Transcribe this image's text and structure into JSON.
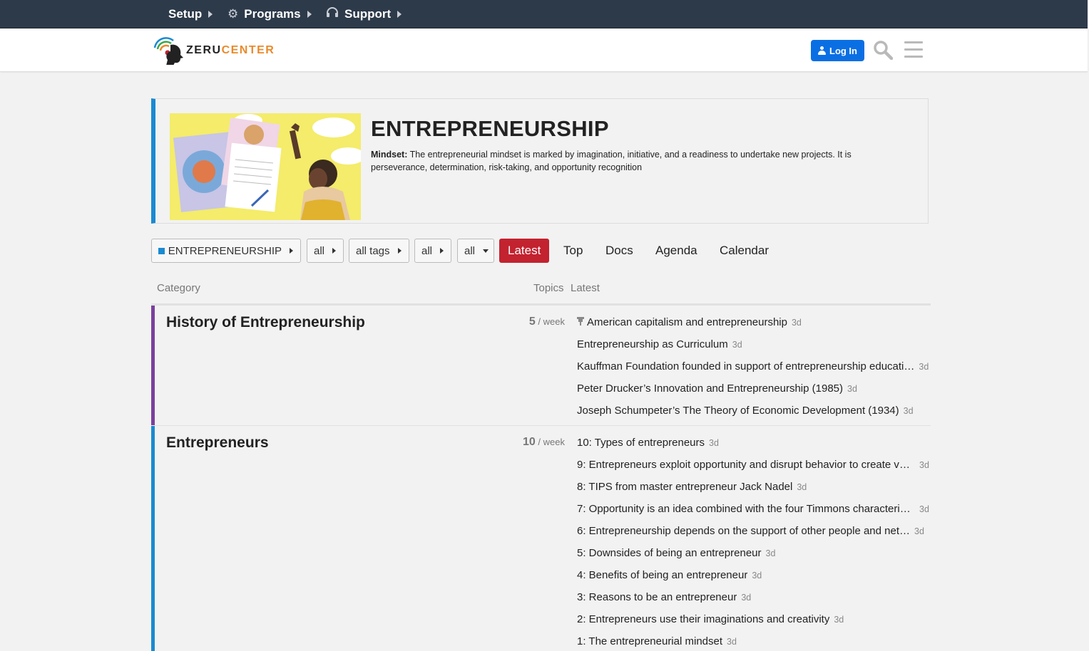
{
  "topnav": {
    "items": [
      {
        "label": "Setup",
        "icon": "none"
      },
      {
        "label": "Programs",
        "icon": "gear-icon"
      },
      {
        "label": "Support",
        "icon": "headset-icon"
      }
    ]
  },
  "header": {
    "logo_text_a": "ZERU",
    "logo_text_b": "CENTER",
    "login_label": "Log In"
  },
  "banner": {
    "title": "ENTREPRENEURSHIP",
    "desc_bold": "Mindset:",
    "desc_text": " The entrepreneurial mindset is marked by imagination, initiative, and a readiness to undertake new projects. It is perseverance, determination, risk-taking, and opportunity recognition",
    "accent_color": "#1a8ad1"
  },
  "filters": {
    "category": "ENTREPRENEURSHIP",
    "sub": "all",
    "tags": "all tags",
    "period": "all",
    "status": "all",
    "tabs": [
      "Latest",
      "Top",
      "Docs",
      "Agenda",
      "Calendar"
    ],
    "active_tab": "Latest",
    "active_color": "#c3222f"
  },
  "table": {
    "headers": {
      "category": "Category",
      "topics": "Topics",
      "latest": "Latest"
    },
    "categories": [
      {
        "name": "History of Entrepreneurship",
        "count": "5",
        "per": " / week",
        "color": "#7b3f9d",
        "topics": [
          {
            "title": "American capitalism and entrepreneurship",
            "age": "3d",
            "pinned": true
          },
          {
            "title": "Entrepreneurship as Curriculum",
            "age": "3d"
          },
          {
            "title": "Kauffman Foundation founded in support of entrepreneurship educati…",
            "age": "3d"
          },
          {
            "title": "Peter Drucker’s Innovation and Entrepreneurship (1985)",
            "age": "3d"
          },
          {
            "title": "Joseph Schumpeter’s The Theory of Economic Development (1934)",
            "age": "3d"
          }
        ]
      },
      {
        "name": "Entrepreneurs",
        "count": "10",
        "per": " / week",
        "color": "#1a8ad1",
        "topics": [
          {
            "title": "10: Types of entrepreneurs",
            "age": "3d"
          },
          {
            "title": "9: Entrepreneurs exploit opportunity and disrupt behavior to create va…",
            "age": "3d"
          },
          {
            "title": "8: TIPS from master entrepreneur Jack Nadel",
            "age": "3d"
          },
          {
            "title": "7: Opportunity is an idea combined with the four Timmons characteris…",
            "age": "3d"
          },
          {
            "title": "6: Entrepreneurship depends on the support of other people and net…",
            "age": "3d"
          },
          {
            "title": "5: Downsides of being an entrepreneur",
            "age": "3d"
          },
          {
            "title": "4: Benefits of being an entrepreneur",
            "age": "3d"
          },
          {
            "title": "3: Reasons to be an entrepreneur",
            "age": "3d"
          },
          {
            "title": "2: Entrepreneurs use their imaginations and creativity",
            "age": "3d"
          },
          {
            "title": "1: The entrepreneurial mindset",
            "age": "3d"
          }
        ]
      }
    ]
  }
}
